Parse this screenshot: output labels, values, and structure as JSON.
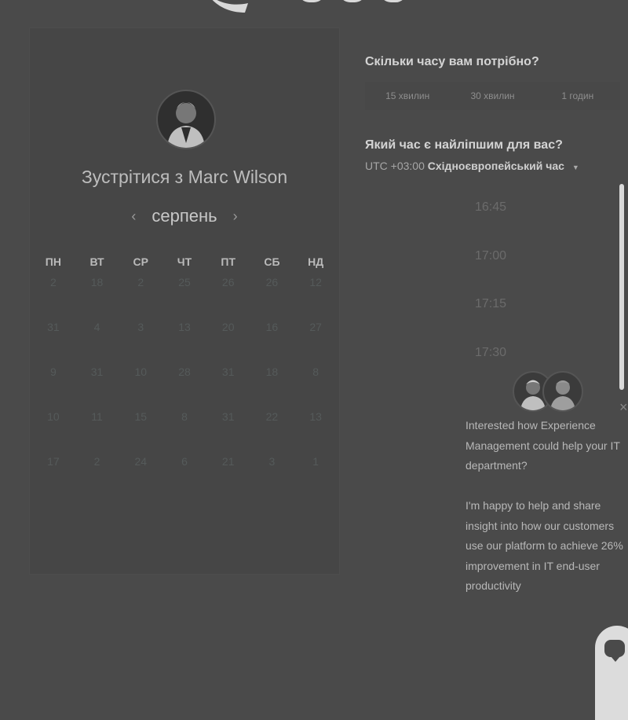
{
  "scheduler": {
    "meet_title": "Зустрітися з Marc Wilson",
    "month": "серпень",
    "prev_icon": "‹",
    "next_icon": "›",
    "weekdays": [
      "ПН",
      "ВТ",
      "СР",
      "ЧТ",
      "ПТ",
      "СБ",
      "НД"
    ],
    "days": [
      "2",
      "18",
      "2",
      "25",
      "26",
      "26",
      "12",
      "31",
      "4",
      "3",
      "13",
      "20",
      "16",
      "27",
      "9",
      "31",
      "10",
      "28",
      "31",
      "18",
      "8",
      "10",
      "11",
      "15",
      "8",
      "31",
      "22",
      "13",
      "17",
      "2",
      "24",
      "6",
      "21",
      "3",
      "1"
    ]
  },
  "duration": {
    "question": "Скільки часу вам потрібно?",
    "options": [
      "15 хвилин",
      "30 хвилин",
      "1 годин"
    ]
  },
  "time": {
    "question": "Який час є найліпшим для вас?",
    "tz_offset": "UTC +03:00",
    "tz_name": "Східноєвропейський час",
    "slots": [
      "16:45",
      "17:00",
      "17:15",
      "17:30"
    ]
  },
  "chat": {
    "close_icon": "×",
    "message_1": "Interested how Experience Management could help your IT department?",
    "message_2": "I'm happy to help and share insight into how our customers use our platform to achieve 26% improvement in IT end-user productivity"
  }
}
